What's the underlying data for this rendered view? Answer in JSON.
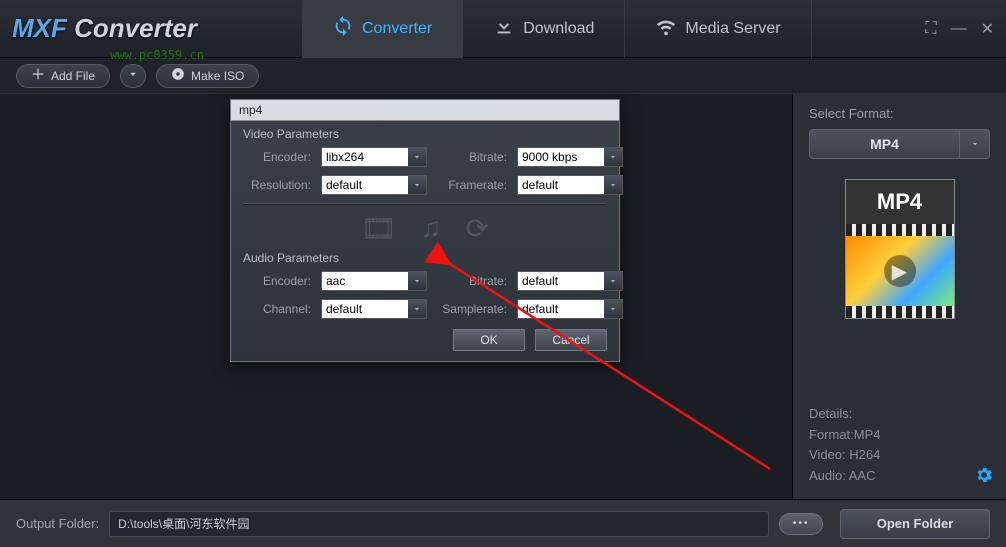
{
  "app_title": "MXF Converter",
  "overlay_url": "www.pc0359.cn",
  "tabs": [
    {
      "label": "Converter",
      "icon": "refresh-icon",
      "active": true
    },
    {
      "label": "Download",
      "icon": "download-icon",
      "active": false
    },
    {
      "label": "Media Server",
      "icon": "wifi-icon",
      "active": false
    }
  ],
  "toolbar": {
    "add_file": "Add File",
    "make_iso": "Make ISO"
  },
  "dialog": {
    "title": "mp4",
    "video_section": "Video Parameters",
    "audio_section": "Audio Parameters",
    "labels": {
      "encoder": "Encoder:",
      "bitrate": "Bitrate:",
      "resolution": "Resolution:",
      "framerate": "Framerate:",
      "channel": "Channel:",
      "samplerate": "Samplerate:"
    },
    "video": {
      "encoder": "libx264",
      "bitrate": "9000 kbps",
      "resolution": "default",
      "framerate": "default"
    },
    "audio": {
      "encoder": "aac",
      "bitrate": "default",
      "channel": "default",
      "samplerate": "default"
    },
    "ok": "OK",
    "cancel": "Cancel"
  },
  "sidebar": {
    "select_format": "Select Format:",
    "format": "MP4",
    "thumb_label": "MP4",
    "details_head": "Details:",
    "details_format": "Format:MP4",
    "details_video": "Video: H264",
    "details_audio": "Audio: AAC"
  },
  "footer": {
    "label": "Output Folder:",
    "path": "D:\\tools\\桌面\\河东软件园",
    "open_folder": "Open Folder"
  }
}
